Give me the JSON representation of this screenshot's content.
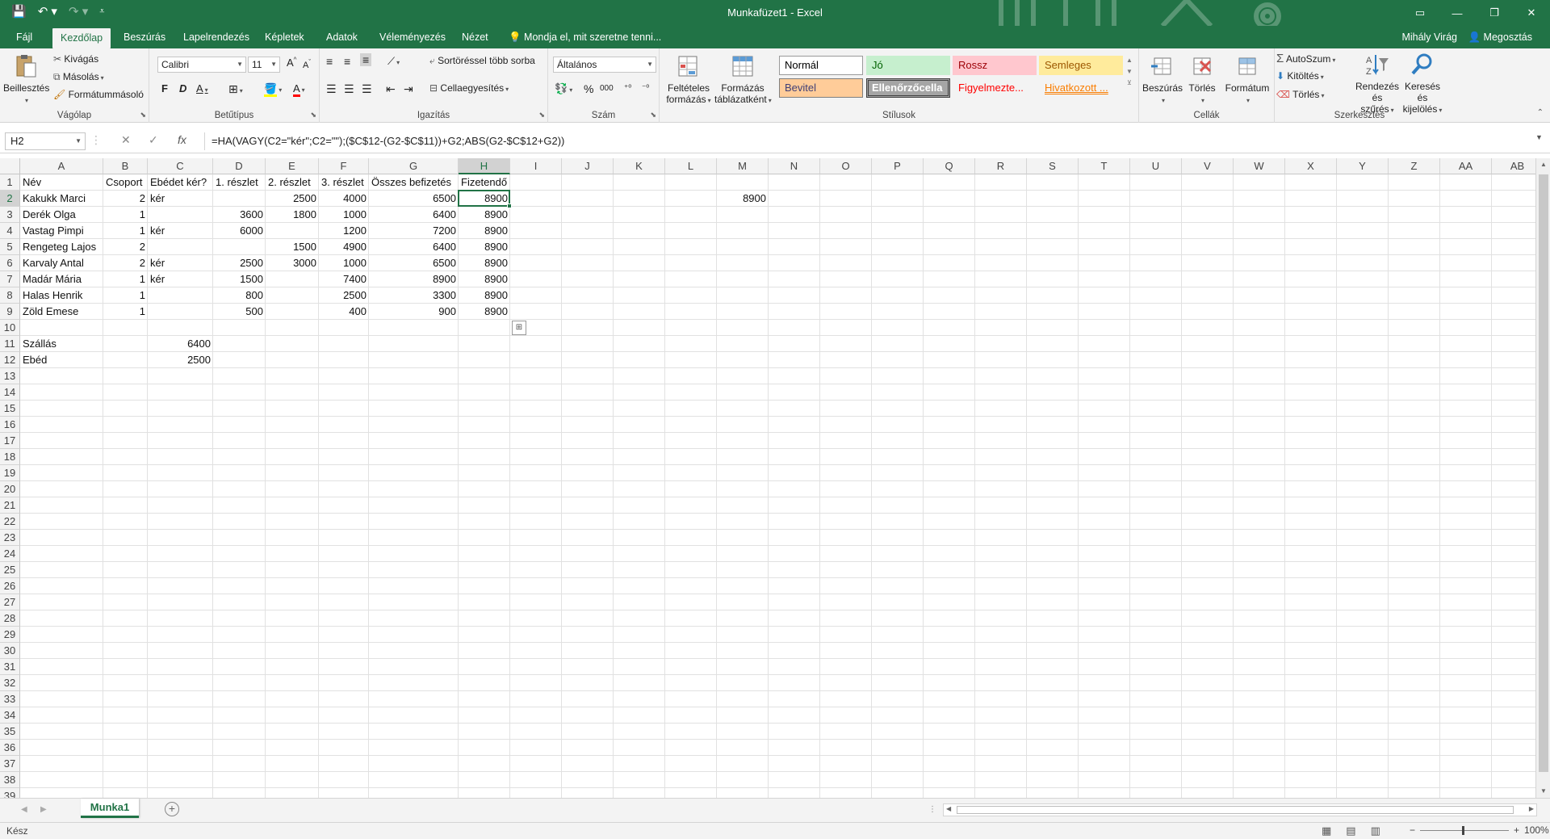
{
  "window": {
    "title": "Munkafüzet1 - Excel",
    "controls": {
      "ribbon_options": "▭",
      "minimize": "—",
      "restore": "❐",
      "close": "✕"
    }
  },
  "qat": {
    "save_icon": "save-icon",
    "undo_icon": "undo-icon",
    "redo_icon": "redo-icon"
  },
  "tabs": [
    {
      "label": "Fájl"
    },
    {
      "label": "Kezdőlap",
      "active": true
    },
    {
      "label": "Beszúrás"
    },
    {
      "label": "Lapelrendezés"
    },
    {
      "label": "Képletek"
    },
    {
      "label": "Adatok"
    },
    {
      "label": "Véleményezés"
    },
    {
      "label": "Nézet"
    }
  ],
  "tell_me": "Mondja el, mit szeretne tenni...",
  "user": "Mihály Virág",
  "share": "Megosztás",
  "ribbon": {
    "clipboard": {
      "label": "Vágólap",
      "paste": "Beillesztés",
      "cut": "Kivágás",
      "copy": "Másolás",
      "format_painter": "Formátummásoló"
    },
    "font": {
      "label": "Betűtípus",
      "family": "Calibri",
      "size": "11",
      "bold": "F",
      "italic": "D",
      "underline": "A"
    },
    "alignment": {
      "label": "Igazítás",
      "wrap": "Sortöréssel több sorba",
      "merge": "Cellaegyesítés"
    },
    "number": {
      "label": "Szám",
      "format": "Általános"
    },
    "styles": {
      "label": "Stílusok",
      "conditional": "Feltételes formázás",
      "as_table": "Formázás táblázatként",
      "cells": [
        {
          "name": "Normál",
          "bg": "#ffffff",
          "fg": "#000000",
          "border": "#9a9a9a"
        },
        {
          "name": "Jó",
          "bg": "#c6efce",
          "fg": "#006100"
        },
        {
          "name": "Rossz",
          "bg": "#ffc7ce",
          "fg": "#9c0006"
        },
        {
          "name": "Semleges",
          "bg": "#ffeb9c",
          "fg": "#9c5700"
        },
        {
          "name": "Bevitel",
          "bg": "#ffcc99",
          "fg": "#3f3f76",
          "border": "#7f7f7f"
        },
        {
          "name": "Ellenőrzőcella",
          "bg": "#a5a5a5",
          "fg": "#ffffff",
          "border": "#3f3f3f"
        },
        {
          "name": "Figyelmezte...",
          "bg": "#f3f3f3",
          "fg": "#ff0000"
        },
        {
          "name": "Hivatkozott ...",
          "bg": "#f3f3f3",
          "fg": "#fa7d00"
        }
      ]
    },
    "cells": {
      "label": "Cellák",
      "insert": "Beszúrás",
      "delete": "Törlés",
      "format": "Formátum"
    },
    "editing": {
      "label": "Szerkesztés",
      "autosum": "AutoSzum",
      "fill": "Kitöltés",
      "clear": "Törlés",
      "sort": "Rendezés és szűrés",
      "find": "Keresés és kijelölés"
    }
  },
  "formula_bar": {
    "name_box": "H2",
    "cancel": "✕",
    "enter": "✓",
    "fx": "fx",
    "formula": "=HA(VAGY(C2=\"kér\";C2=\"\");($C$12-(G2-$C$11))+G2;ABS(G2-$C$12+G2))"
  },
  "columns": [
    "A",
    "B",
    "C",
    "D",
    "E",
    "F",
    "G",
    "H",
    "I",
    "J",
    "K",
    "L",
    "M",
    "N",
    "O",
    "P",
    "Q",
    "R",
    "S",
    "T",
    "U",
    "V",
    "W",
    "X",
    "Y",
    "Z",
    "AA",
    "AB"
  ],
  "selected_col": "H",
  "selected_row": 2,
  "rows_visible": 39,
  "sheet": {
    "headers": [
      "Név",
      "Csoport",
      "Ebédet kér?",
      "1. részlet",
      "2. részlet",
      "3. részlet",
      "Összes befizetés",
      "Fizetendő"
    ],
    "rows": [
      [
        "Kakukk Marci",
        "2",
        "kér",
        "",
        "2500",
        "4000",
        "6500",
        "8900"
      ],
      [
        "Derék Olga",
        "1",
        "",
        "3600",
        "1800",
        "1000",
        "6400",
        "8900"
      ],
      [
        "Vastag Pimpi",
        "1",
        "kér",
        "6000",
        "",
        "1200",
        "7200",
        "8900"
      ],
      [
        "Rengeteg Lajos",
        "2",
        "",
        "",
        "1500",
        "4900",
        "6400",
        "8900"
      ],
      [
        "Karvaly Antal",
        "2",
        "kér",
        "2500",
        "3000",
        "1000",
        "6500",
        "8900"
      ],
      [
        "Madár Mária",
        "1",
        "kér",
        "1500",
        "",
        "7400",
        "8900",
        "8900"
      ],
      [
        "Halas Henrik",
        "1",
        "",
        "800",
        "",
        "2500",
        "3300",
        "8900"
      ],
      [
        "Zöld Emese",
        "1",
        "",
        "500",
        "",
        "400",
        "900",
        "8900"
      ]
    ],
    "extra": [
      {
        "ref": "A11",
        "text": "Szállás",
        "num": false
      },
      {
        "ref": "C11",
        "text": "6400",
        "num": true
      },
      {
        "ref": "A12",
        "text": "Ebéd",
        "num": false
      },
      {
        "ref": "C12",
        "text": "2500",
        "num": true
      },
      {
        "ref": "M2",
        "text": "8900",
        "num": true
      }
    ]
  },
  "sheet_tab": "Munka1",
  "status": {
    "ready": "Kész",
    "zoom": "100%"
  }
}
